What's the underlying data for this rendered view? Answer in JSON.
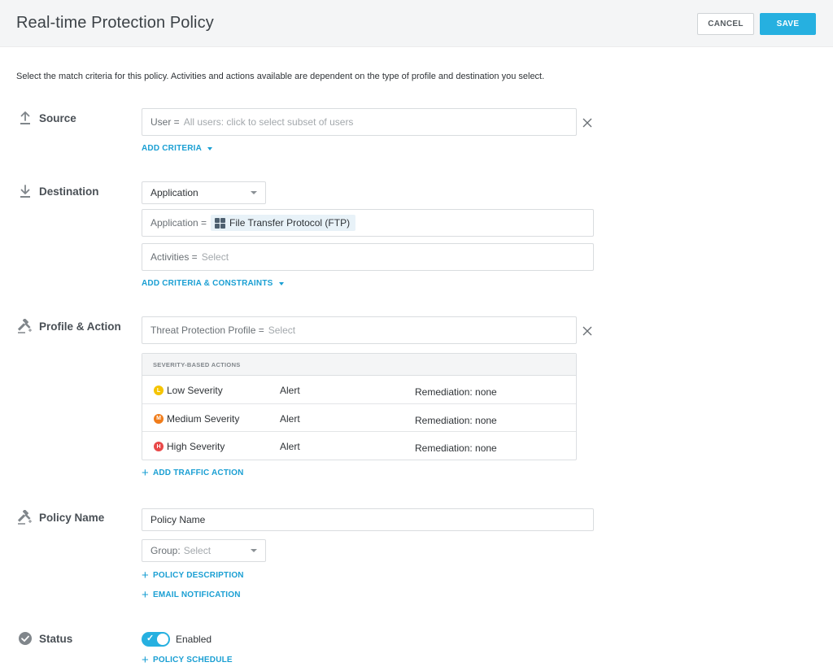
{
  "header": {
    "title": "Real-time Protection Policy",
    "cancel_label": "CANCEL",
    "save_label": "SAVE"
  },
  "instructions": "Select the match criteria for this policy. Activities and actions available are dependent on the type of profile and destination you select.",
  "source": {
    "label": "Source",
    "icon": "upload-icon",
    "user_field": {
      "label": "User =",
      "placeholder": "All users: click to select subset of users"
    },
    "add_criteria": "ADD CRITERIA"
  },
  "destination": {
    "label": "Destination",
    "icon": "download-icon",
    "type_select": "Application",
    "application_field": {
      "label": "Application =",
      "chip": "File Transfer Protocol (FTP)",
      "chip_icon": "app-grid-icon"
    },
    "activities_field": {
      "label": "Activities =",
      "placeholder": "Select"
    },
    "add_criteria": "ADD CRITERIA & CONSTRAINTS"
  },
  "profile_action": {
    "label": "Profile & Action",
    "icon": "gavel-icon",
    "profile_field": {
      "label": "Threat Protection Profile =",
      "placeholder": "Select"
    },
    "table_header": "SEVERITY-BASED ACTIONS",
    "rows": [
      {
        "badge": "L",
        "severity": "Low Severity",
        "action": "Alert",
        "remediation": "Remediation: none",
        "color": "#f5c400"
      },
      {
        "badge": "M",
        "severity": "Medium Severity",
        "action": "Alert",
        "remediation": "Remediation: none",
        "color": "#f07c1a"
      },
      {
        "badge": "H",
        "severity": "High Severity",
        "action": "Alert",
        "remediation": "Remediation: none",
        "color": "#e94848"
      }
    ],
    "add_traffic_action": "ADD TRAFFIC ACTION"
  },
  "policy_name": {
    "label": "Policy Name",
    "icon": "gavel-icon",
    "name_value": "Policy Name",
    "group_label": "Group:",
    "group_placeholder": "Select",
    "policy_description": "POLICY DESCRIPTION",
    "email_notification": "EMAIL NOTIFICATION"
  },
  "status": {
    "label": "Status",
    "icon": "check-circle-icon",
    "toggle_on": true,
    "toggle_label": "Enabled",
    "policy_schedule": "POLICY SCHEDULE"
  },
  "colors": {
    "accent": "#26b0e0",
    "link": "#1a9fd3"
  }
}
